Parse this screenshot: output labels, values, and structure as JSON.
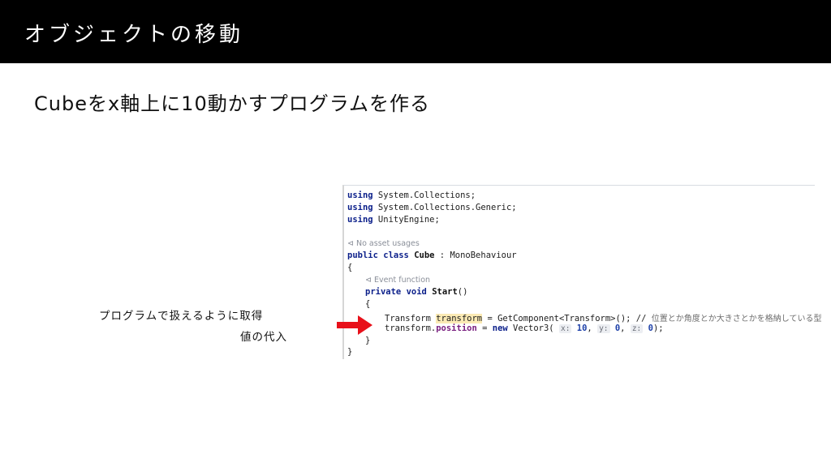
{
  "slide": {
    "title": "オブジェクトの移動",
    "subtitle": "Cubeをx軸上に10動かすプログラムを作る"
  },
  "code": {
    "using1_kw": "using",
    "using1_ns": " System.Collections;",
    "using2_kw": "using",
    "using2_ns": " System.Collections.Generic;",
    "using3_kw": "using",
    "using3_ns": " UnityEngine;",
    "hint_usages": "No asset usages",
    "class_kw": "public class",
    "class_name": "Cube",
    "class_base": " : MonoBehaviour",
    "brace_open": "{",
    "hint_event": "Event function",
    "method_kw": "private void",
    "method_name": "Start",
    "method_parens": "()",
    "inner_open": "{",
    "line1_type": "Transform",
    "line1_var": "transform",
    "line1_rest": " = GetComponent<Transform>(); //",
    "line1_comment": "位置とか角度とか大きさとかを格納している型",
    "line2_obj": "transform.",
    "line2_field": "position",
    "line2_eq": " = ",
    "line2_new": "new",
    "line2_call": " Vector3(",
    "param_x": "x:",
    "val_x": "10",
    "param_y": "y:",
    "val_y": "0",
    "param_z": "z:",
    "val_z": "0",
    "line2_end": ");",
    "inner_close": "}",
    "brace_close": "}"
  },
  "annotation": {
    "line1": "プログラムで扱えるように取得",
    "line2": "値の代入"
  },
  "colors": {
    "arrow": "#e8101a",
    "titlebar": "#000000"
  }
}
